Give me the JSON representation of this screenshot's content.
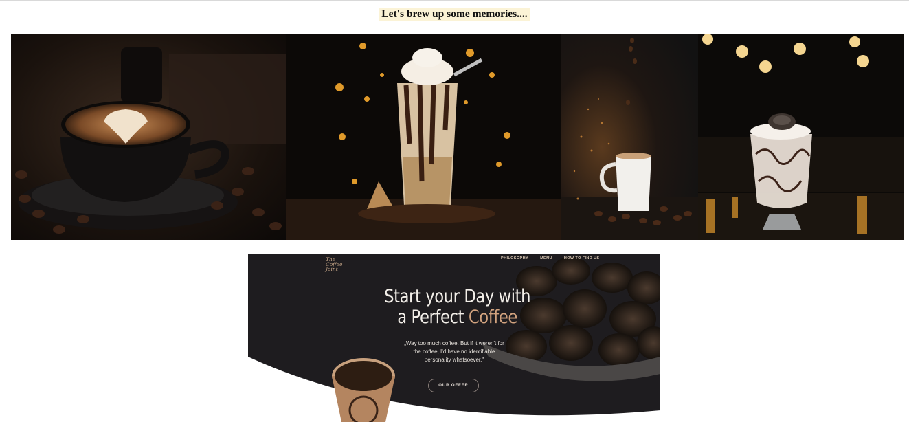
{
  "header": {
    "title": "Let's brew up some memories...."
  },
  "gallery": {
    "images": [
      {
        "name": "latte-art-cup-image"
      },
      {
        "name": "chocolate-frappe-image"
      },
      {
        "name": "white-coffee-mug-image"
      },
      {
        "name": "cookie-milkshake-image"
      }
    ]
  },
  "preview": {
    "logo": "The Coffee Joint",
    "nav": [
      "PHILOSOPHY",
      "MENU",
      "HOW TO FIND US"
    ],
    "hero_title_line1": "Start your Day with",
    "hero_title_line2_prefix": "a Perfect ",
    "hero_title_line2_accent": "Coffee",
    "quote": "„Way too much coffee. But if it weren't for the coffee, I'd have no identifiable personality whatsoever.\"",
    "cta_label": "OUR OFFER",
    "colors": {
      "accent": "#d1a27e",
      "background": "#1e1c1f"
    }
  }
}
